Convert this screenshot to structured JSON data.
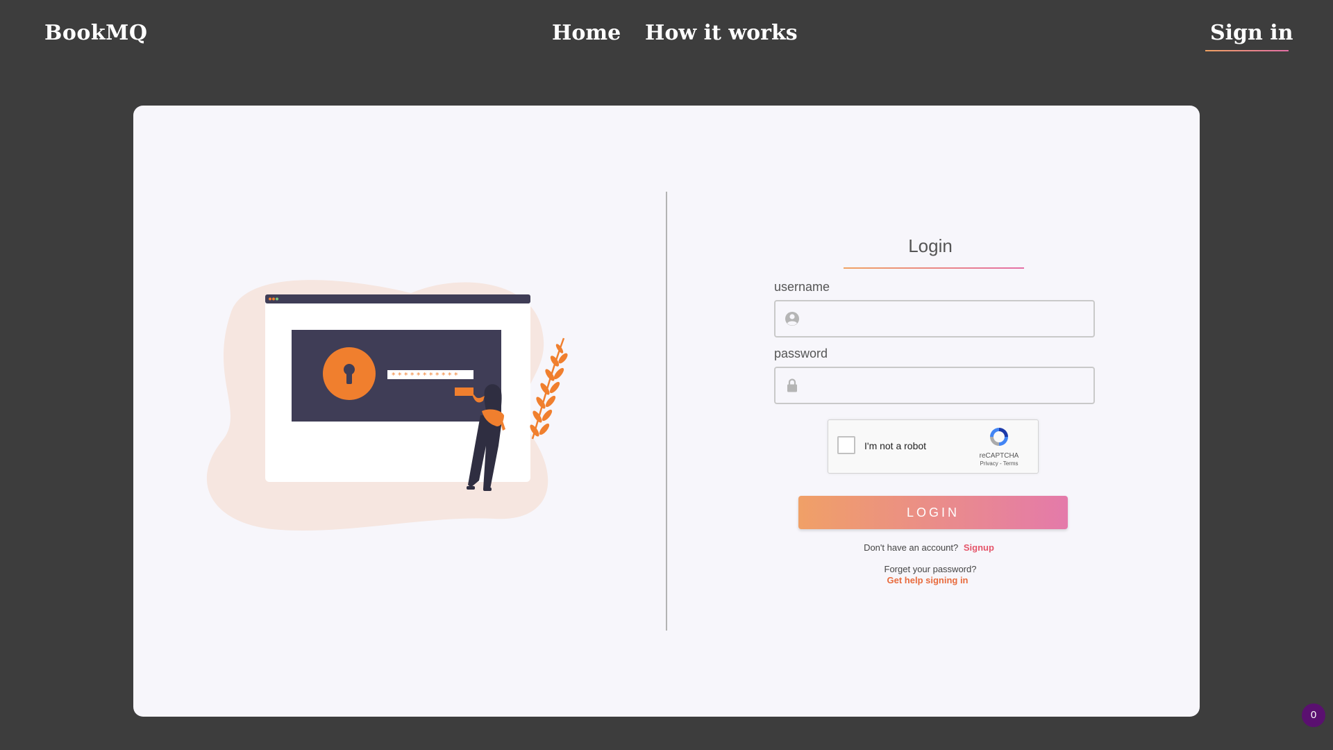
{
  "nav": {
    "brand": "BookMQ",
    "links": [
      {
        "label": "Home"
      },
      {
        "label": "How it works"
      }
    ],
    "signin": "Sign in",
    "accent_gradient": [
      "#f0a262",
      "#e46fa6"
    ]
  },
  "login": {
    "title": "Login",
    "username_label": "username",
    "password_label": "password",
    "username_icon": "user-circle-icon",
    "password_icon": "lock-icon",
    "username_value": "",
    "password_value": "",
    "captcha": {
      "label": "I'm not a robot",
      "brand": "reCAPTCHA",
      "links": "Privacy - Terms",
      "checked": false
    },
    "button": "LOGIN",
    "signup_prompt": "Don't have an account?",
    "signup_link": "Signup",
    "forgot_prompt": "Forget your password?",
    "help_link": "Get help signing in"
  },
  "badge": {
    "count": "0"
  },
  "colors": {
    "page_bg": "#3d3d3d",
    "card_bg": "#f7f6fb",
    "illustration_primary": "#f07f2e",
    "illustration_dark": "#3f3d56",
    "link_accent": "#e5556a"
  }
}
